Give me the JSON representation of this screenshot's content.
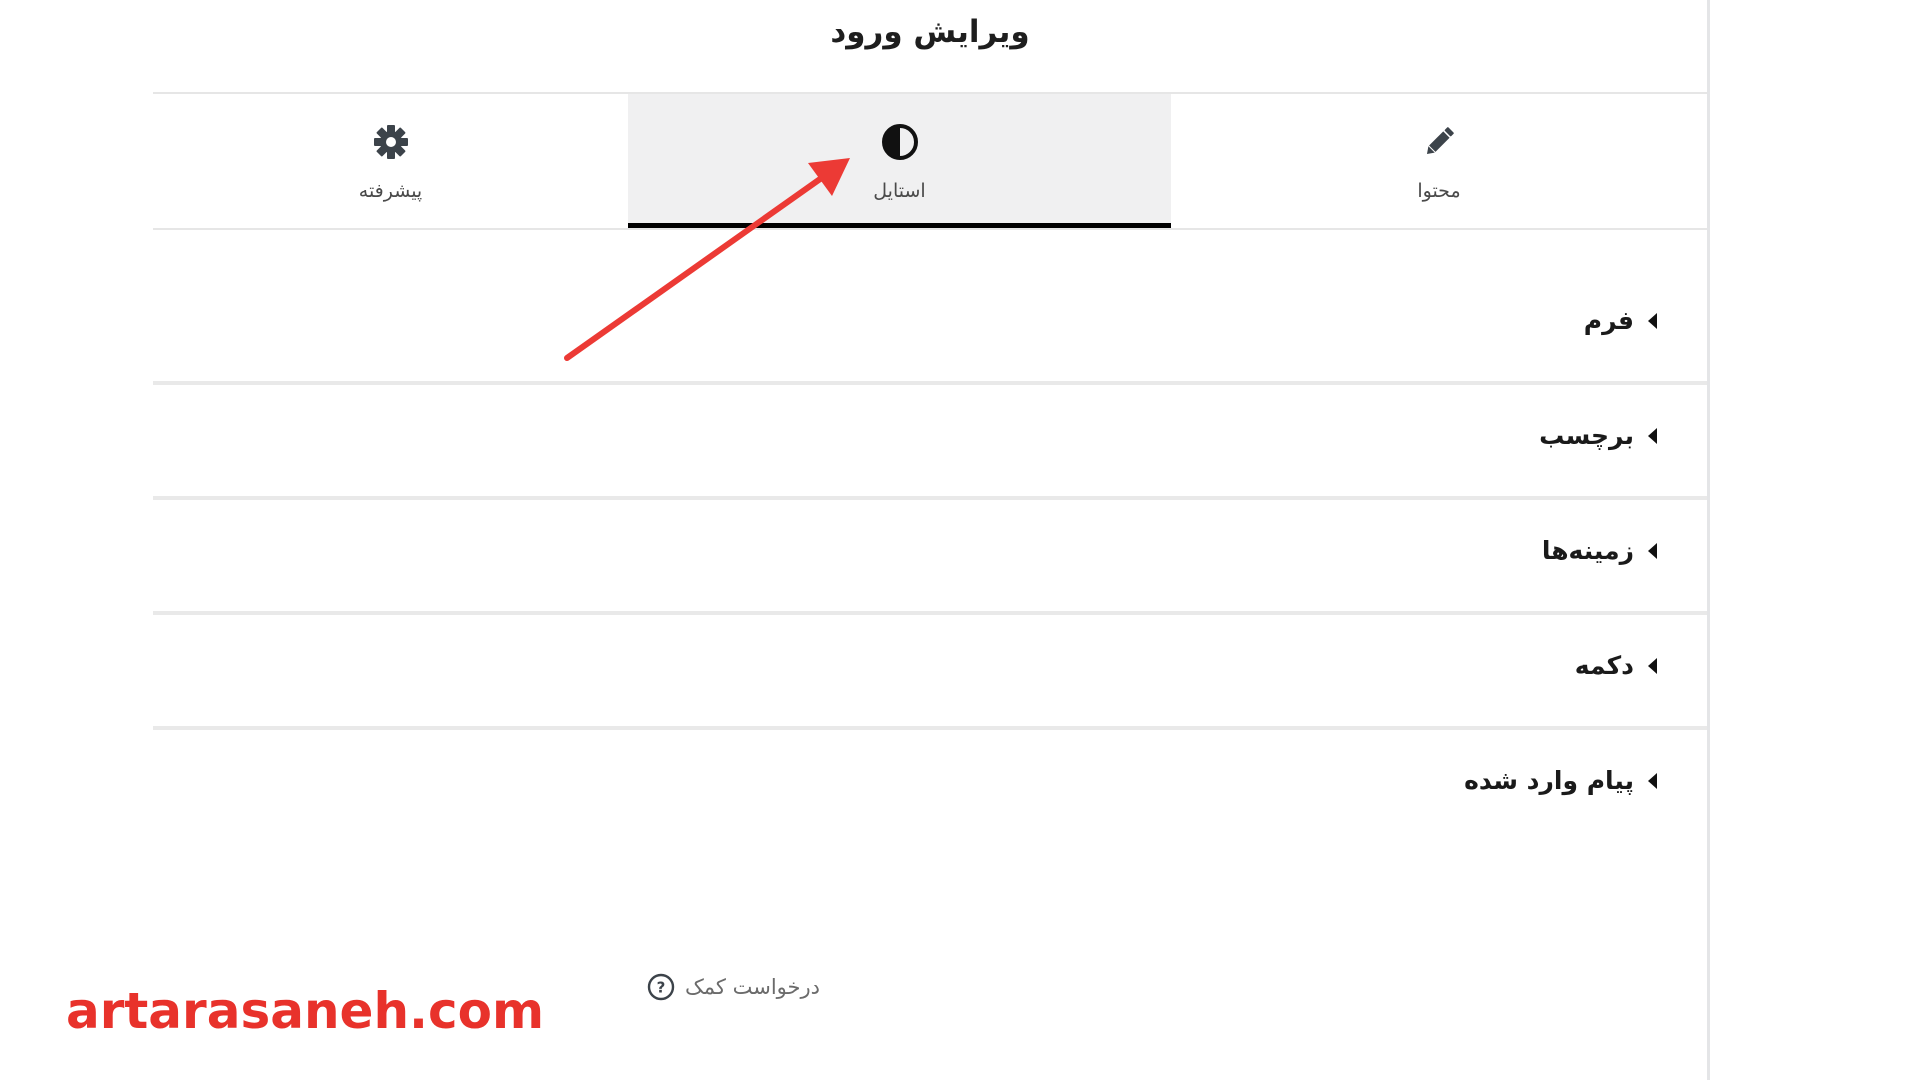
{
  "panel": {
    "title": "ویرایش ورود"
  },
  "tabs": [
    {
      "label": "پیشرفته",
      "icon": "gear-icon"
    },
    {
      "label": "استایل",
      "icon": "half-circle-icon",
      "active": true
    },
    {
      "label": "محتوا",
      "icon": "pencil-icon"
    }
  ],
  "sections": [
    {
      "label": "فرم"
    },
    {
      "label": "برچسب"
    },
    {
      "label": "زمینه‌ها"
    },
    {
      "label": "دکمه"
    },
    {
      "label": "پیام وارد شده"
    }
  ],
  "help": {
    "label": "درخواست کمک",
    "icon": "question-circle-icon"
  },
  "watermark": {
    "text": "artarasaneh.com"
  },
  "colors": {
    "accent": "#e8322b",
    "active_tab_bg": "#f0f0f1",
    "active_tab_border": "#000000"
  }
}
